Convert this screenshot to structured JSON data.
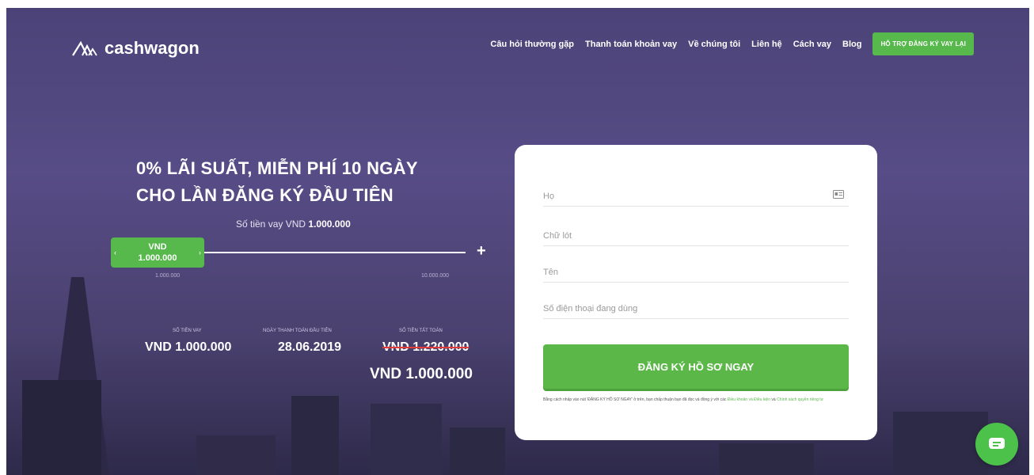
{
  "brand": {
    "name": "cashwagon",
    "accent": "#57b84b",
    "bg": "#514877"
  },
  "nav": {
    "links": [
      "Câu hỏi thường gặp",
      "Thanh toán khoản vay",
      "Về chúng tôi",
      "Liên hệ",
      "Cách vay",
      "Blog"
    ],
    "cta": "HỖ TRỢ ĐĂNG KÝ VAY LẠI"
  },
  "hero": {
    "headline_line1": "0% LÃI SUẤT, MIỄN PHÍ 10 NGÀY",
    "headline_line2": "CHO LẦN ĐĂNG KÝ ĐẦU TIÊN",
    "amount_prefix": "Số tiền vay VND",
    "amount_value": "1.000.000"
  },
  "slider": {
    "handle_currency": "VND",
    "handle_value": "1.000.000",
    "min_label": "1.000.000",
    "max_label": "10.000.000",
    "plus": "+",
    "left_chevron": "‹",
    "right_chevron": "›"
  },
  "stats": {
    "loan_label": "SỐ TIỀN VAY",
    "loan_value": "VND 1.000.000",
    "date_label": "NGÀY THANH TOÁN ĐẦU TIÊN",
    "date_value": "28.06.2019",
    "total_label": "SỐ TIỀN TẤT TOÁN",
    "total_old": "VND 1.220.000",
    "total_new": "VND 1.000.000"
  },
  "form": {
    "last_name_placeholder": "Họ",
    "middle_name_placeholder": "Chữ lót",
    "first_name_placeholder": "Tên",
    "phone_placeholder": "Số điện thoại đang dùng",
    "submit_label": "ĐĂNG KÝ HỒ SƠ NGAY",
    "disclaimer_text": "Bằng cách nhấp vào nút 'ĐĂNG KÝ HỒ SƠ NGAY' ở trên, bạn chấp thuận bạn đã đọc và đồng ý với các",
    "terms_link": "Điều khoản và Điều kiện",
    "disclaimer_and": "và",
    "privacy_link": "Chính sách quyền riêng tư"
  },
  "icons": {
    "chat": "chat-icon",
    "id_card": "id-card-icon",
    "logo": "cashwagon-logo-icon"
  }
}
